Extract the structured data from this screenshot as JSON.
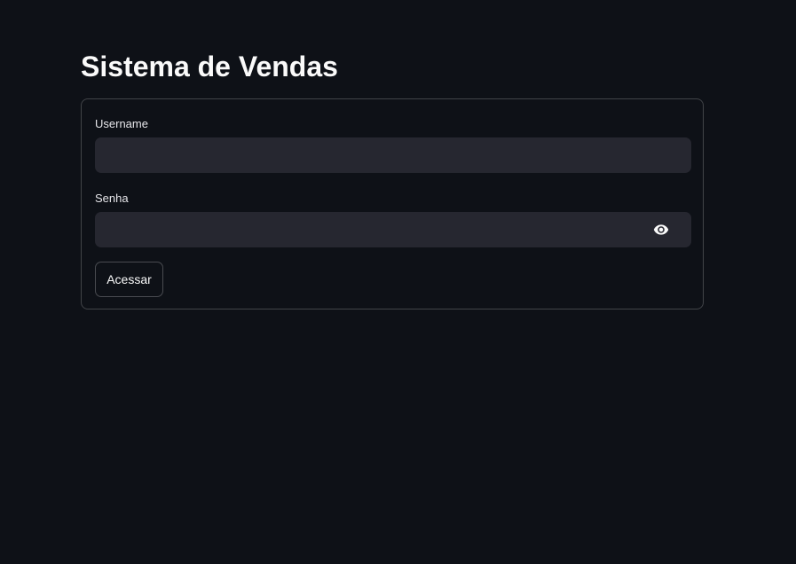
{
  "page": {
    "title": "Sistema de Vendas"
  },
  "form": {
    "username_label": "Username",
    "username_value": "",
    "password_label": "Senha",
    "password_value": "",
    "password_toggle_icon": "eye-icon",
    "submit_label": "Acessar"
  },
  "colors": {
    "background": "#0e1117",
    "input_background": "#262730",
    "text": "#fafafa"
  }
}
